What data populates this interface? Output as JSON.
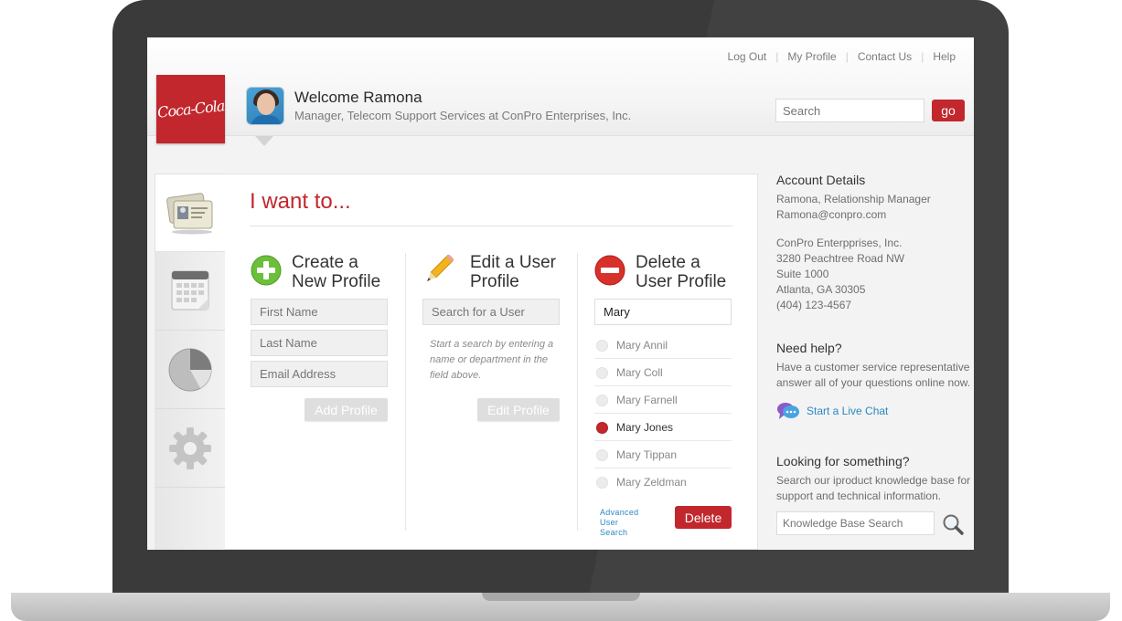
{
  "header": {
    "logo_text": "Coca-Cola",
    "links": [
      "Log Out",
      "My Profile",
      "Contact Us",
      "Help"
    ],
    "welcome": "Welcome Ramona",
    "role": "Manager, Telecom Support Services at ConPro Enterprises, Inc.",
    "search_placeholder": "Search",
    "go_label": "go"
  },
  "sidebar": {
    "items": [
      {
        "icon": "id-cards-icon",
        "active": true
      },
      {
        "icon": "calendar-icon",
        "active": false
      },
      {
        "icon": "pie-chart-icon",
        "active": false
      },
      {
        "icon": "gear-icon",
        "active": false
      }
    ]
  },
  "main": {
    "heading": "I want to...",
    "create": {
      "title_line1": "Create a",
      "title_line2": "New Profile",
      "first_name_placeholder": "First Name",
      "last_name_placeholder": "Last Name",
      "email_placeholder": "Email Address",
      "button": "Add Profile"
    },
    "edit": {
      "title_line1": "Edit a User",
      "title_line2": "Profile",
      "search_placeholder": "Search for a User",
      "hint": "Start a search by entering a name or department in the field above.",
      "button": "Edit Profile"
    },
    "delete": {
      "title_line1": "Delete a",
      "title_line2": "User Profile",
      "search_value": "Mary",
      "users": [
        {
          "name": "Mary Annil",
          "selected": false
        },
        {
          "name": "Mary Coll",
          "selected": false
        },
        {
          "name": "Mary Farnell",
          "selected": false
        },
        {
          "name": "Mary Jones",
          "selected": true
        },
        {
          "name": "Mary Tippan",
          "selected": false
        },
        {
          "name": "Mary Zeldman",
          "selected": false
        }
      ],
      "advanced_line1": "Advanced",
      "advanced_line2": "User Search",
      "button": "Delete"
    }
  },
  "account": {
    "heading": "Account Details",
    "name_role": "Ramona, Relationship Manager",
    "email": "Ramona@conpro.com",
    "company": "ConPro Enterpprises, Inc.",
    "street": "3280 Peachtree Road NW",
    "suite": "Suite 1000",
    "city": "Atlanta, GA  30305",
    "phone": "(404) 123-4567"
  },
  "help": {
    "heading": "Need help?",
    "line1": "Have a customer service representative",
    "line2": "answer all of your questions online now.",
    "chat_link": "Start a Live Chat"
  },
  "kb": {
    "heading": "Looking for something?",
    "line1": "Search our iproduct knowledge base for",
    "line2": "support and technical information.",
    "placeholder": "Knowledge Base Search"
  },
  "colors": {
    "brand_red": "#c1272d",
    "link_blue": "#2a89c1"
  }
}
